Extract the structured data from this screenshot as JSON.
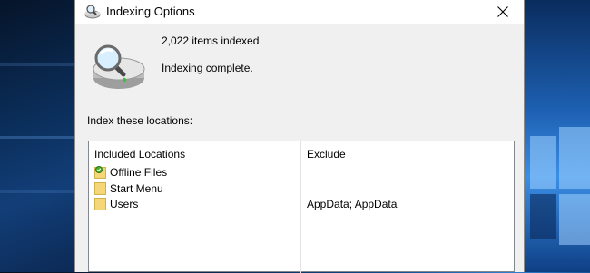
{
  "window": {
    "title": "Indexing Options",
    "close_icon": "close-icon"
  },
  "summary": {
    "items_indexed": "2,022 items indexed",
    "status": "Indexing complete.",
    "icon": "indexing-drive-magnifier-icon"
  },
  "locations": {
    "label": "Index these locations:",
    "columns": {
      "included": "Included Locations",
      "exclude": "Exclude"
    },
    "rows": [
      {
        "name": "Offline Files",
        "exclude": "",
        "icon": "offline-folder-icon"
      },
      {
        "name": "Start Menu",
        "exclude": "",
        "icon": "folder-icon"
      },
      {
        "name": "Users",
        "exclude": "AppData; AppData",
        "icon": "folder-icon"
      }
    ]
  },
  "colors": {
    "window_bg": "#f0f0f0",
    "titlebar_bg": "#ffffff",
    "folder": "#f5d77a",
    "sync_green": "#4caf28"
  }
}
